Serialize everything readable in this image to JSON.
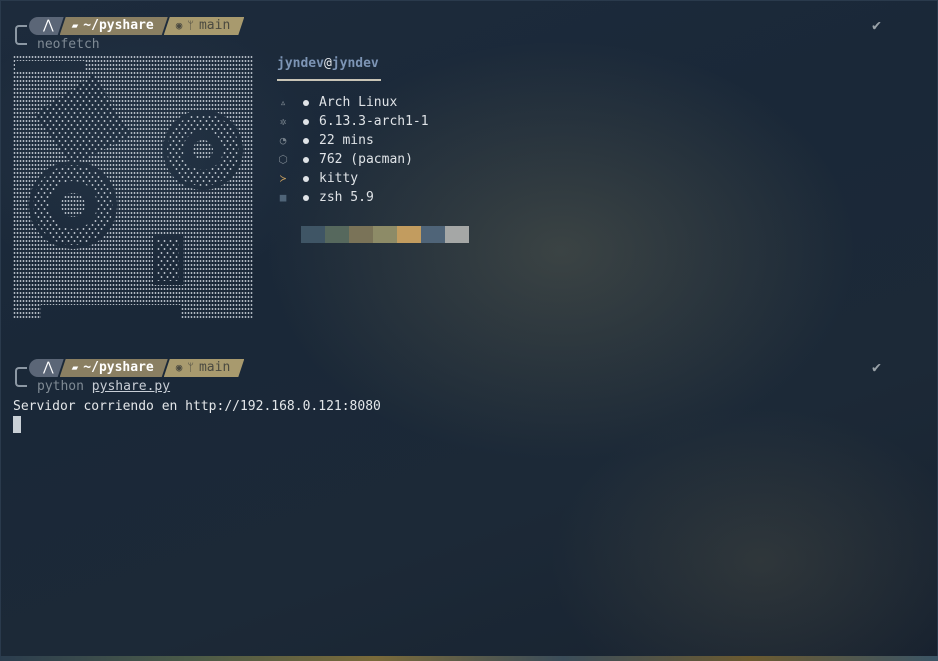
{
  "prompts": [
    {
      "os_icon": "arch-logo-icon",
      "folder_icon": "folder-icon",
      "path": "~/pyshare",
      "git_icon": "github-icon",
      "branch_icon": "git-branch-icon",
      "branch": "main",
      "status_icon": "check-icon",
      "status_glyph": "✔",
      "command": "neofetch",
      "command_arg": ""
    },
    {
      "os_icon": "arch-logo-icon",
      "folder_icon": "folder-icon",
      "path": "~/pyshare",
      "git_icon": "github-icon",
      "branch_icon": "git-branch-icon",
      "branch": "main",
      "status_icon": "check-icon",
      "status_glyph": "✔",
      "command": "python",
      "command_arg": "pyshare.py"
    }
  ],
  "neofetch": {
    "user": "jyndev",
    "at": "@",
    "host": "jyndev",
    "rows": [
      {
        "icon": "linux-penguin-icon",
        "value": "Arch Linux"
      },
      {
        "icon": "chip-icon",
        "value": "6.13.3-arch1-1"
      },
      {
        "icon": "clock-icon",
        "value": "22 mins"
      },
      {
        "icon": "package-icon",
        "value": "762 (pacman)"
      },
      {
        "icon": "terminal-icon",
        "value": "kitty"
      },
      {
        "icon": "shell-icon",
        "value": "zsh 5.9"
      }
    ],
    "palette": [
      "#3f5565",
      "#56685d",
      "#7a7358",
      "#8d8b67",
      "#c29c5f",
      "#4f6478",
      "#a5a7a6"
    ]
  },
  "output": {
    "line": "Servidor corriendo en http://192.168.0.121:8080"
  },
  "colors": {
    "background": "#1b2a3b",
    "accent_user": "#7d95b5",
    "segment_dir": "#8a7f62",
    "segment_git": "#a89a6e"
  }
}
